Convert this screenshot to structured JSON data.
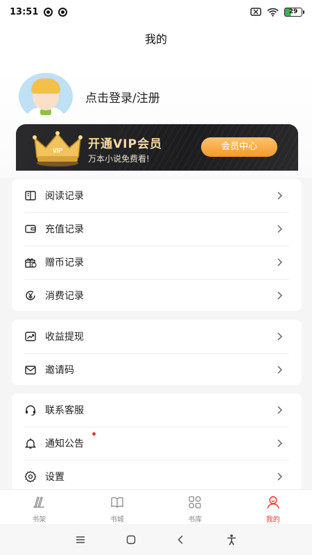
{
  "status_bar": {
    "time": "13:51",
    "battery": "29"
  },
  "header": {
    "title": "我的"
  },
  "profile": {
    "login_label": "点击登录/注册"
  },
  "vip": {
    "title": "开通VIP会员",
    "subtitle": "万本小说免费看!",
    "button": "会员中心",
    "crown_text": "VIP"
  },
  "menu_group1": [
    {
      "label": "阅读记录",
      "icon": "book-icon"
    },
    {
      "label": "充值记录",
      "icon": "wallet-icon"
    },
    {
      "label": "赠币记录",
      "icon": "gift-icon"
    },
    {
      "label": "消费记录",
      "icon": "yen-icon"
    }
  ],
  "menu_group2": [
    {
      "label": "收益提现",
      "icon": "trend-icon"
    },
    {
      "label": "邀请码",
      "icon": "mail-icon"
    }
  ],
  "menu_group3": [
    {
      "label": "联系客服",
      "icon": "headset-icon"
    },
    {
      "label": "通知公告",
      "icon": "bell-icon",
      "has_dot": true
    },
    {
      "label": "设置",
      "icon": "gear-icon"
    }
  ],
  "tabbar": [
    {
      "label": "书架",
      "icon": "bookshelf-icon",
      "active": false
    },
    {
      "label": "书城",
      "icon": "bookstore-icon",
      "active": false
    },
    {
      "label": "书库",
      "icon": "library-icon",
      "active": false
    },
    {
      "label": "我的",
      "icon": "profile-icon",
      "active": true
    }
  ],
  "colors": {
    "accent": "#e23b32",
    "vip_gold": "#f6d9a6",
    "vip_button": "#f39a2c"
  }
}
